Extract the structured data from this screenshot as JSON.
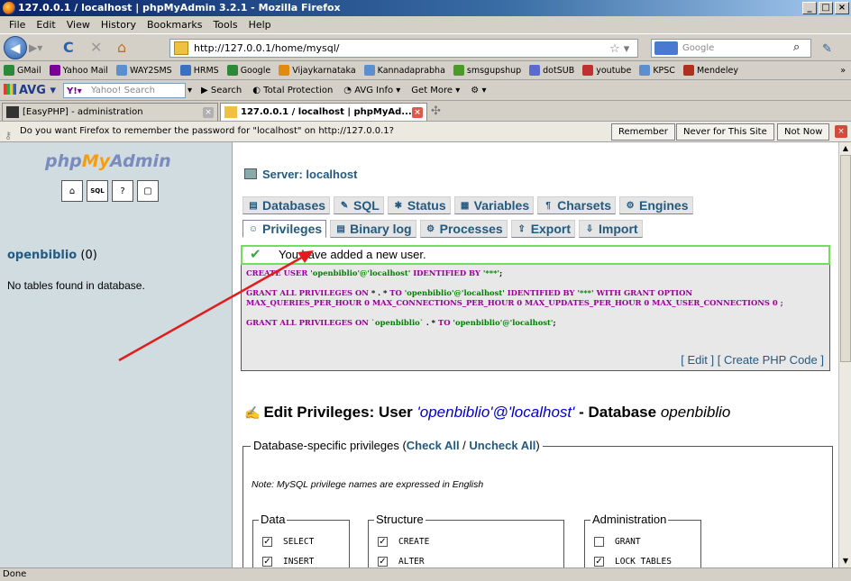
{
  "window": {
    "title": "127.0.0.1 / localhost | phpMyAdmin 3.2.1 - Mozilla Firefox"
  },
  "menu": [
    "File",
    "Edit",
    "View",
    "History",
    "Bookmarks",
    "Tools",
    "Help"
  ],
  "nav": {
    "url": "http://127.0.0.1/home/mysql/",
    "search_placeholder": "Google"
  },
  "bookmarks": [
    {
      "label": "GMail",
      "icon": "gmail-icon",
      "color": "#2a8a3a"
    },
    {
      "label": "Yahoo Mail",
      "icon": "yahoo-icon",
      "color": "#7b0099"
    },
    {
      "label": "WAY2SMS",
      "icon": "page-icon",
      "color": "#5b8fd0"
    },
    {
      "label": "HRMS",
      "icon": "hrms-icon",
      "color": "#3a70c0"
    },
    {
      "label": "Google",
      "icon": "google-icon",
      "color": "#2a8a3a"
    },
    {
      "label": "Vijaykarnataka",
      "icon": "vk-icon",
      "color": "#e28a10"
    },
    {
      "label": "Kannadaprabha",
      "icon": "page-icon",
      "color": "#5b8fd0"
    },
    {
      "label": "smsgupshup",
      "icon": "sms-icon",
      "color": "#4a9a2a"
    },
    {
      "label": "dotSUB",
      "icon": "dotsub-icon",
      "color": "#5a6ad0"
    },
    {
      "label": "youtube",
      "icon": "youtube-icon",
      "color": "#c03030"
    },
    {
      "label": "KPSC",
      "icon": "page-icon",
      "color": "#5b8fd0"
    },
    {
      "label": "Mendeley",
      "icon": "mendeley-icon",
      "color": "#b03020"
    }
  ],
  "avg": {
    "logo": "AVG",
    "yahoo_placeholder": "Yahoo! Search",
    "items": [
      "Search",
      "Total Protection",
      "AVG Info",
      "Get More"
    ]
  },
  "tabs": [
    {
      "label": "[EasyPHP] - administration",
      "active": false
    },
    {
      "label": "127.0.0.1 / localhost | phpMyAd...",
      "active": true
    }
  ],
  "pwbar": {
    "message": "Do you want Firefox to remember the password for \"localhost\" on http://127.0.0.1?",
    "remember": "Remember",
    "never": "Never for This Site",
    "notnow": "Not Now"
  },
  "left": {
    "logo_php": "php",
    "logo_my": "My",
    "logo_admin": "Admin",
    "db_name": "openbiblio",
    "db_count": "(0)",
    "no_tables": "No tables found in database."
  },
  "server": {
    "label": "Server: localhost"
  },
  "tabs_row1": [
    {
      "label": "Databases",
      "icon": "databases-icon"
    },
    {
      "label": "SQL",
      "icon": "sql-icon"
    },
    {
      "label": "Status",
      "icon": "status-icon"
    },
    {
      "label": "Variables",
      "icon": "variables-icon"
    },
    {
      "label": "Charsets",
      "icon": "charsets-icon"
    },
    {
      "label": "Engines",
      "icon": "engines-icon"
    }
  ],
  "tabs_row2": [
    {
      "label": "Privileges",
      "icon": "privileges-icon",
      "active": true
    },
    {
      "label": "Binary log",
      "icon": "binarylog-icon"
    },
    {
      "label": "Processes",
      "icon": "processes-icon"
    },
    {
      "label": "Export",
      "icon": "export-icon"
    },
    {
      "label": "Import",
      "icon": "import-icon"
    }
  ],
  "success": {
    "message": "You have added a new user."
  },
  "sql": {
    "line1_kw1": "CREATE USER",
    "line1_str1": "'openbiblio'@'localhost'",
    "line1_kw2": "IDENTIFIED BY",
    "line1_str2": "'***'",
    "line2_kw1": "GRANT ALL PRIVILEGES ON",
    "line2_mid": " * . * ",
    "line2_kw2": "TO",
    "line2_str1": "'openbiblio'@'localhost'",
    "line2_kw3": "IDENTIFIED BY",
    "line2_str2": "'***'",
    "line2_kw4": "WITH GRANT OPTION",
    "line3": "MAX_QUERIES_PER_HOUR 0 MAX_CONNECTIONS_PER_HOUR 0 MAX_UPDATES_PER_HOUR 0 MAX_USER_CONNECTIONS 0 ;",
    "line4_kw1": "GRANT ALL PRIVILEGES ON",
    "line4_str1": "`openbiblio`",
    "line4_mid": " . * ",
    "line4_kw2": "TO",
    "line4_str2": "'openbiblio'@'localhost'",
    "edit_link": "Edit",
    "php_link": "Create PHP Code"
  },
  "edit_priv": {
    "prefix": "Edit Privileges: User",
    "user": "'openbiblio'@'localhost'",
    "middle": "- Database",
    "db": "openbiblio"
  },
  "db_privs": {
    "legend_prefix": "Database-specific privileges (",
    "check_all": "Check All",
    "sep": " / ",
    "uncheck_all": "Uncheck All",
    "legend_suffix": ")",
    "note": "Note: MySQL privilege names are expressed in English",
    "groups": [
      {
        "label": "Data",
        "items": [
          {
            "name": "SELECT",
            "checked": true
          },
          {
            "name": "INSERT",
            "checked": true
          }
        ]
      },
      {
        "label": "Structure",
        "items": [
          {
            "name": "CREATE",
            "checked": true
          },
          {
            "name": "ALTER",
            "checked": true
          }
        ]
      },
      {
        "label": "Administration",
        "items": [
          {
            "name": "GRANT",
            "checked": false
          },
          {
            "name": "LOCK TABLES",
            "checked": true
          }
        ]
      }
    ]
  },
  "status": {
    "text": "Done"
  }
}
